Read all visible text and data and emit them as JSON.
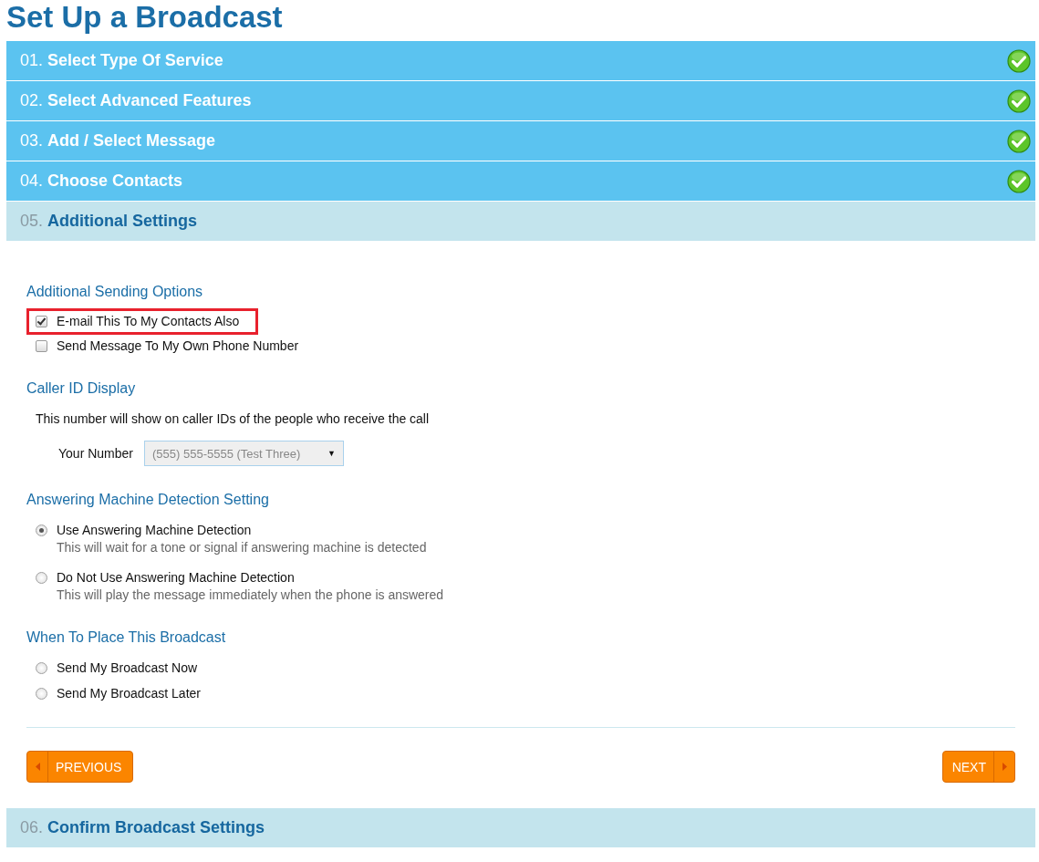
{
  "page_title": "Set Up a Broadcast",
  "steps": [
    {
      "number": "01.",
      "title": "Select Type Of Service",
      "completed": true
    },
    {
      "number": "02.",
      "title": "Select Advanced Features",
      "completed": true
    },
    {
      "number": "03.",
      "title": "Add / Select Message",
      "completed": true
    },
    {
      "number": "04.",
      "title": "Choose Contacts",
      "completed": true
    },
    {
      "number": "05.",
      "title": "Additional Settings",
      "completed": false
    }
  ],
  "sections": [
    {
      "heading": "Additional Sending Options",
      "items": [
        {
          "kind": "checkbox",
          "label": "E-mail This To My Contacts Also",
          "checked": true,
          "highlighted": true
        },
        {
          "kind": "checkbox",
          "label": "Send Message To My Own Phone Number",
          "checked": false,
          "highlighted": false
        }
      ]
    },
    {
      "heading": "Caller ID Display",
      "items": [
        {
          "kind": "note",
          "text": "This number will show on caller IDs of the people who receive the call"
        },
        {
          "kind": "select",
          "label": "Your Number",
          "value": "(555) 555-5555 (Test Three)",
          "arrow": "▼"
        }
      ]
    },
    {
      "heading": "Answering Machine Detection Setting",
      "items": [
        {
          "kind": "radio",
          "label": "Use Answering Machine Detection",
          "hint": "This will wait for a tone or signal if answering machine is detected",
          "selected": true
        },
        {
          "kind": "radio",
          "label": "Do Not Use Answering Machine Detection",
          "hint": "This will play the message immediately when the phone is answered",
          "selected": false
        }
      ]
    },
    {
      "heading": "When To Place This Broadcast",
      "items": [
        {
          "kind": "radio",
          "label": "Send My Broadcast Now",
          "selected": false
        },
        {
          "kind": "radio",
          "label": "Send My Broadcast Later",
          "selected": false
        }
      ]
    }
  ],
  "buttons": {
    "previous": "PREVIOUS",
    "next": "NEXT"
  },
  "later_steps": [
    {
      "number": "06.",
      "title": "Confirm Broadcast Settings",
      "completed": false
    }
  ]
}
